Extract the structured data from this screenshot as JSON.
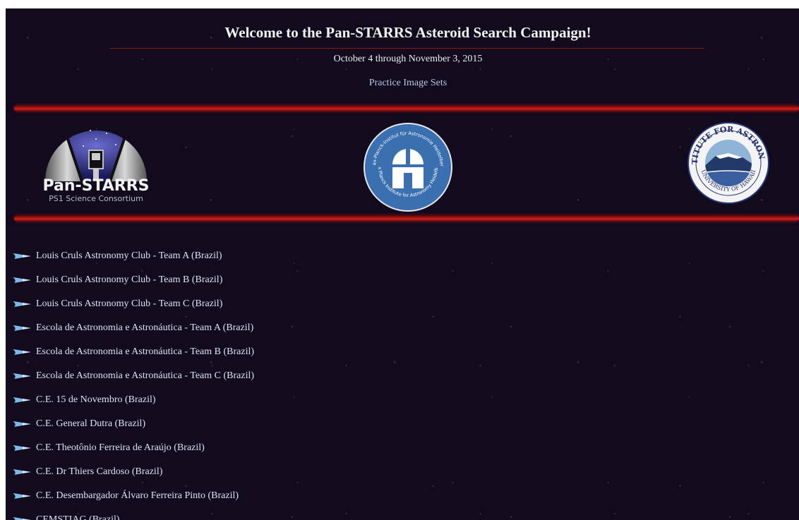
{
  "header": {
    "title": "Welcome to the Pan-STARRS Asteroid Search Campaign!",
    "dates": "October 4 through November 3, 2015",
    "practice_link": "Practice Image Sets"
  },
  "logos": {
    "panstarrs": {
      "name": "Pan-STARRS",
      "subtitle": "PS1 Science Consortium"
    },
    "mpia": {
      "ring_text_top": "Max-Planck-Institut für Astronomie Heidelberg",
      "ring_text_bottom": "Max Planck Institute for Astronomy Heidelberg"
    },
    "ifa": {
      "ring_text_top": "INSTITUTE FOR ASTRONOMY",
      "ring_text_bottom": "UNIVERSITY OF HAWAII"
    }
  },
  "teams": [
    {
      "label": "Louis Cruls Astronomy Club - Team A (Brazil)"
    },
    {
      "label": "Louis Cruls Astronomy Club - Team B (Brazil)"
    },
    {
      "label": "Louis Cruls Astronomy Club - Team C (Brazil)"
    },
    {
      "label": "Escola de Astronomia e Astronáutica - Team A (Brazil)"
    },
    {
      "label": "Escola de Astronomia e Astronáutica - Team B (Brazil)"
    },
    {
      "label": "Escola de Astronomia e Astronáutica - Team C (Brazil)"
    },
    {
      "label": "C.E. 15 de Novembro (Brazil)"
    },
    {
      "label": "C.E. General Dutra (Brazil)"
    },
    {
      "label": "C.E. Theotônio Ferreira de Araújo (Brazil)"
    },
    {
      "label": "C.E. Dr Thiers Cardoso (Brazil)"
    },
    {
      "label": "C.E. Desembargador Álvaro Ferreira Pinto (Brazil)"
    },
    {
      "label": "CEMSTIAG (Brazil)"
    }
  ],
  "colors": {
    "background": "#120a1d",
    "accent_red": "#b01616",
    "link": "#dfe4f5"
  },
  "icons": {
    "bullet": "blue-comet-bullet-icon"
  }
}
